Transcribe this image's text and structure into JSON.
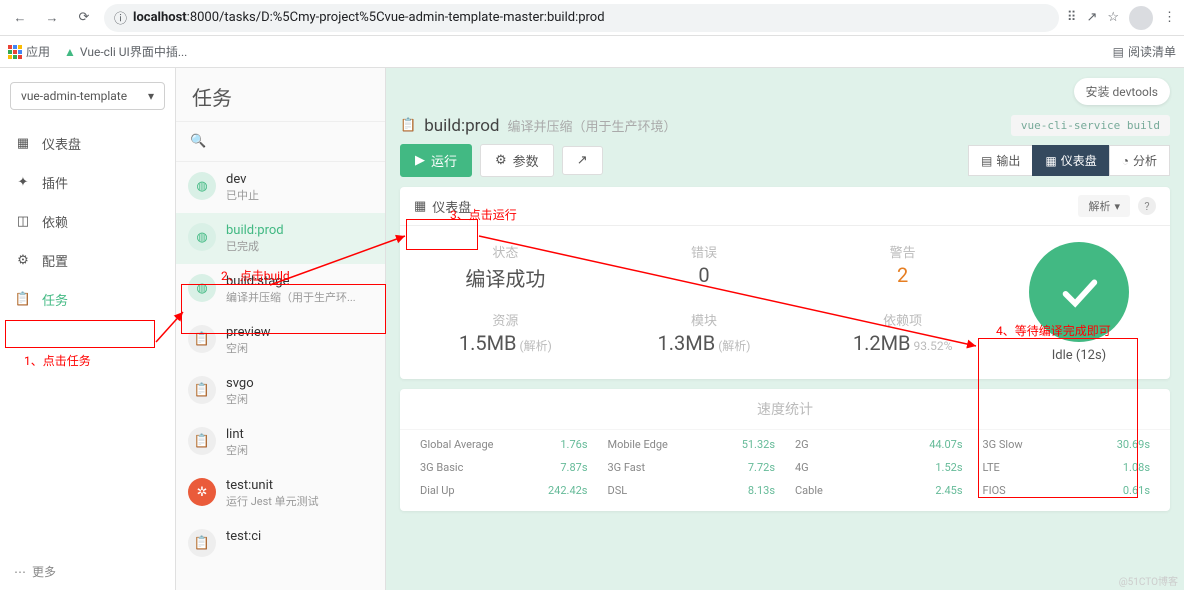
{
  "browser": {
    "url_prefix": "localhost",
    "url_rest": ":8000/tasks/D:%5Cmy-project%5Cvue-admin-template-master:build:prod",
    "bookmarks": {
      "apps": "应用",
      "vuecli": "Vue-cli UI界面中插...",
      "reading_list": "阅读清单"
    }
  },
  "sidebar": {
    "project": "vue-admin-template",
    "items": [
      {
        "label": "仪表盘"
      },
      {
        "label": "插件"
      },
      {
        "label": "依赖"
      },
      {
        "label": "配置"
      },
      {
        "label": "任务"
      }
    ],
    "more": "更多"
  },
  "tasks": {
    "title": "任务",
    "search_placeholder": "",
    "list": [
      {
        "name": "dev",
        "sub": "已中止",
        "icon": "cube"
      },
      {
        "name": "build:prod",
        "sub": "已完成",
        "icon": "cube",
        "selected": true
      },
      {
        "name": "build:stage",
        "sub": "编译并压缩（用于生产环...",
        "icon": "cube"
      },
      {
        "name": "preview",
        "sub": "空闲",
        "icon": "clip"
      },
      {
        "name": "svgo",
        "sub": "空闲",
        "icon": "clip"
      },
      {
        "name": "lint",
        "sub": "空闲",
        "icon": "clip"
      },
      {
        "name": "test:unit",
        "sub": "运行 Jest 单元测试",
        "icon": "test"
      },
      {
        "name": "test:ci",
        "sub": "",
        "icon": "clip"
      }
    ]
  },
  "main": {
    "devtools": "安装 devtools",
    "title": "build:prod",
    "desc": "编译并压缩（用于生产环境）",
    "cmd": "vue-cli-service build",
    "buttons": {
      "run": "运行",
      "params": "参数",
      "output": "输出",
      "dashboard": "仪表盘",
      "analyze": "分析"
    },
    "dash_header": "仪表盘",
    "parse_select": "解析",
    "stats": {
      "status_label": "状态",
      "status_value": "编译成功",
      "errors_label": "错误",
      "errors_value": "0",
      "warnings_label": "警告",
      "warnings_value": "2",
      "assets_label": "资源",
      "assets_value": "1.5MB",
      "assets_note": "(解析)",
      "modules_label": "模块",
      "modules_value": "1.3MB",
      "modules_note": "(解析)",
      "deps_label": "依赖项",
      "deps_value": "1.2MB",
      "deps_note": "93.52%"
    },
    "idle": "Idle (12s)",
    "speed_title": "速度统计",
    "speeds": [
      {
        "n": "Global Average",
        "v": "1.76s"
      },
      {
        "n": "Mobile Edge",
        "v": "51.32s"
      },
      {
        "n": "2G",
        "v": "44.07s"
      },
      {
        "n": "3G Slow",
        "v": "30.69s"
      },
      {
        "n": "3G Basic",
        "v": "7.87s"
      },
      {
        "n": "3G Fast",
        "v": "7.72s"
      },
      {
        "n": "4G",
        "v": "1.52s"
      },
      {
        "n": "LTE",
        "v": "1.08s"
      },
      {
        "n": "Dial Up",
        "v": "242.42s"
      },
      {
        "n": "DSL",
        "v": "8.13s"
      },
      {
        "n": "Cable",
        "v": "2.45s"
      },
      {
        "n": "FIOS",
        "v": "0.61s"
      }
    ]
  },
  "annotations": {
    "a1": "1、点击任务",
    "a2": "2、点击build",
    "a3": "3、点击运行",
    "a4": "4、等待编译完成即可"
  },
  "watermark": "@51CTO博客"
}
